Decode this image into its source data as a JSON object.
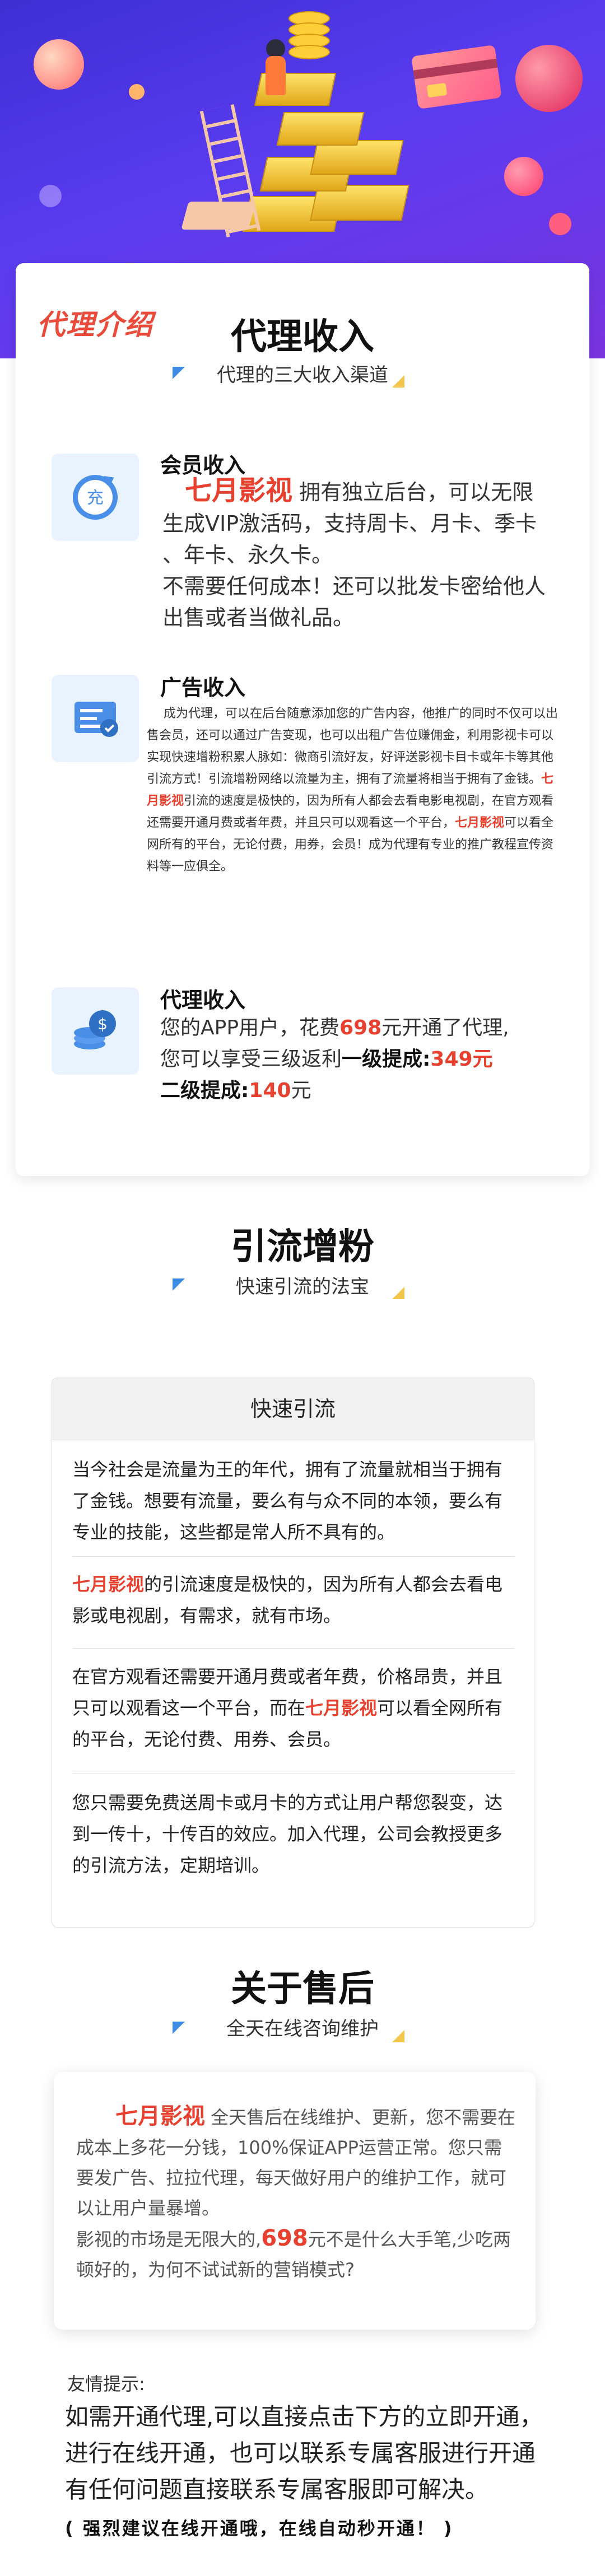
{
  "logo": "代理介绍",
  "section1": {
    "title": "代理收入",
    "subtitle": "代理的三大收入渠道",
    "items": [
      {
        "title": "会员收入",
        "icon": "recharge-icon",
        "brand": "七月影视",
        "line1": " 拥有独立后台，可以无限",
        "lines": [
          "生成VIP激活码，支持周卡、月卡、季卡",
          "、年卡、永久卡。",
          "不需要任何成本！还可以批发卡密给他人",
          "出售或者当做礼品。"
        ]
      },
      {
        "title": "广告收入",
        "icon": "ad-board-icon",
        "p1": "成为代理，可以在后台随意添加您的广告内容，他推广的同时不仅可以出售会员，还可以通过广告变现，也可以出租广告位赚佣金，利用影视卡可以实现快速增粉积累人脉如：微商引流好友，好评送影视卡目卡或年卡等其他引流方式！引流增粉网络以流量为主，拥有了流量将相当于拥有了金钱。",
        "brand": "七月影视",
        "p2": "引流的速度是极快的，因为所有人都会去看电影电视剧，在官方观看还需要开通月费或者年费，并且只可以观看这一个平台，",
        "p3": "可以看全网所有的平台，无论付费，用券，会员！成为代理有专业的推广教程宣传资料等一应俱全。"
      },
      {
        "title": "代理收入",
        "icon": "coins-icon",
        "t1": "您的APP用户，花费",
        "price": "698",
        "t2": "元开通了代理,",
        "t3": "您可以享受三级返利",
        "level1_label": "一级提成:",
        "level1_value": "349元",
        "level2_label": "二级提成:",
        "level2_value": "140",
        "level2_unit": "元"
      }
    ]
  },
  "section2": {
    "title": "引流增粉",
    "subtitle": "快速引流的法宝",
    "box_title": "快速引流",
    "p1": "当今社会是流量为王的年代，拥有了流量就相当于拥有了金钱。想要有流量，要么有与众不同的本领，要么有专业的技能，这些都是常人所不具有的。",
    "p2_brand": "七月影视",
    "p2": "的引流速度是极快的，因为所有人都会去看电影或电视剧，有需求，就有市场。",
    "p3a": "在官方观看还需要开通月费或者年费，价格昂贵，并且只可以观看这一个平台，而在",
    "p3_brand": "七月影视",
    "p3b": "可以看全网所有的平台，无论付费、用券、会员。",
    "p4": "您只需要免费送周卡或月卡的方式让用户帮您裂变，达到一传十，十传百的效应。加入代理，公司会教授更多的引流方法，定期培训。"
  },
  "section3": {
    "title": "关于售后",
    "subtitle": "全天在线咨询维护",
    "brand": "七月影视",
    "p1": " 全天售后在线维护、更新，您不需要在成本上多花一分钱，100%保证APP运营正常。您只需要发广告、拉拉代理，每天做好用户的维护工作，就可以让用户量暴增。",
    "p2a": "影视的市场是无限大的,",
    "p2_price": "698",
    "p2b": "元不是什么大手笔,少吃两顿好的，为何不试试新的营销模式?"
  },
  "tips": {
    "label": "友情提示:",
    "lines": [
      "如需开通代理,可以直接点击下方的立即开通，",
      "进行在线开通，也可以联系专属客服进行开通",
      "有任何问题直接联系专属客服即可解决。"
    ],
    "note": "( 强烈建议在线开通哦，在线自动秒开通！ )"
  },
  "colors": {
    "accent_red": "#e8402e",
    "hero_purple": "#4a34e0",
    "corner_blue": "#3f8ce6",
    "corner_gold": "#f2c64d"
  }
}
